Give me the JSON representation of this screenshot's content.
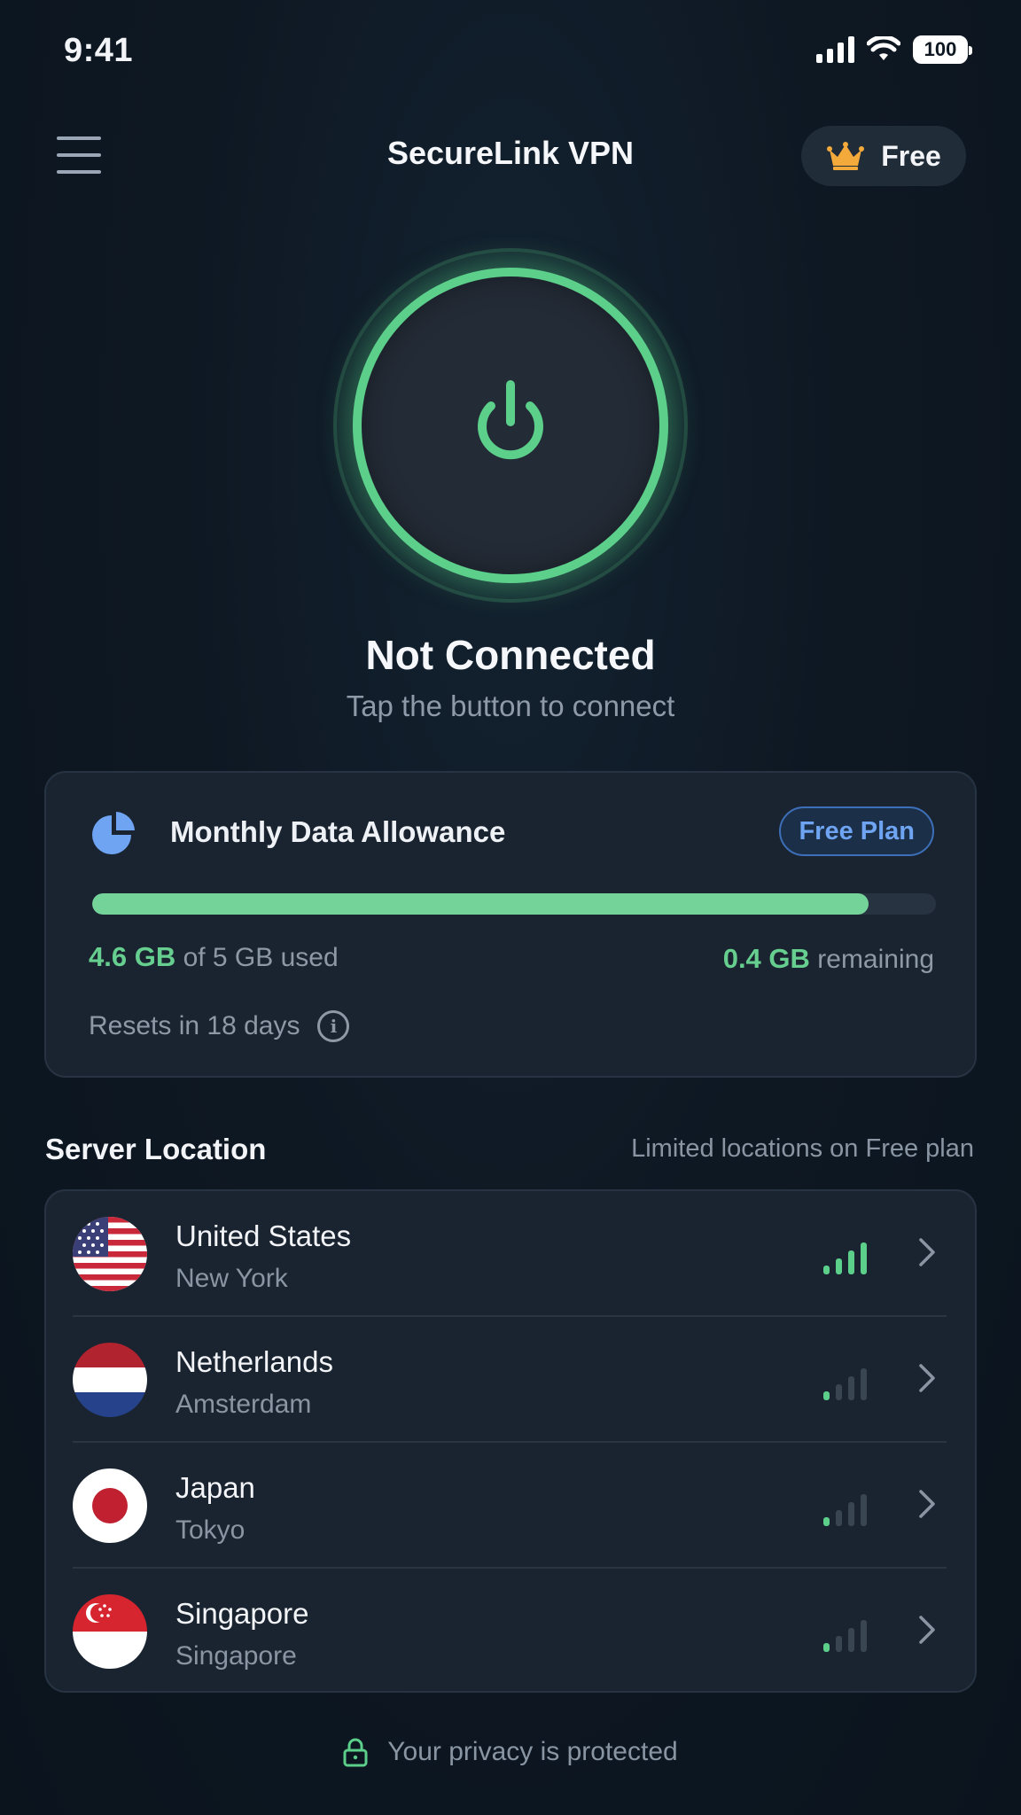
{
  "status_bar": {
    "time": "9:41",
    "battery": "100"
  },
  "header": {
    "title": "SecureLink VPN",
    "plan_label": "Free"
  },
  "connection": {
    "status": "Not Connected",
    "hint": "Tap the button to connect"
  },
  "data_card": {
    "title": "Monthly Data Allowance",
    "badge": "Free Plan",
    "used_value": "4.6 GB",
    "used_suffix": "of 5 GB used",
    "remaining_value": "0.4 GB",
    "remaining_suffix": "remaining",
    "reset_text": "Resets in 18 days",
    "used_fraction": 0.92
  },
  "servers": {
    "heading": "Server Location",
    "note": "Limited locations on Free plan",
    "items": [
      {
        "country": "United States",
        "city": "New York",
        "flag": "us-flag",
        "signal_level": 4
      },
      {
        "country": "Netherlands",
        "city": "Amsterdam",
        "flag": "nl-flag",
        "signal_level": 1
      },
      {
        "country": "Japan",
        "city": "Tokyo",
        "flag": "jp-flag",
        "signal_level": 1
      },
      {
        "country": "Singapore",
        "city": "Singapore",
        "flag": "sg-flag",
        "signal_level": 1
      }
    ]
  },
  "footer": {
    "text": "Your privacy is protected"
  },
  "colors": {
    "accent_green": "#5ccf8b",
    "accent_blue": "#6ea4f2",
    "crown_orange": "#f4a93b",
    "signal_inactive": "#3a4552"
  }
}
